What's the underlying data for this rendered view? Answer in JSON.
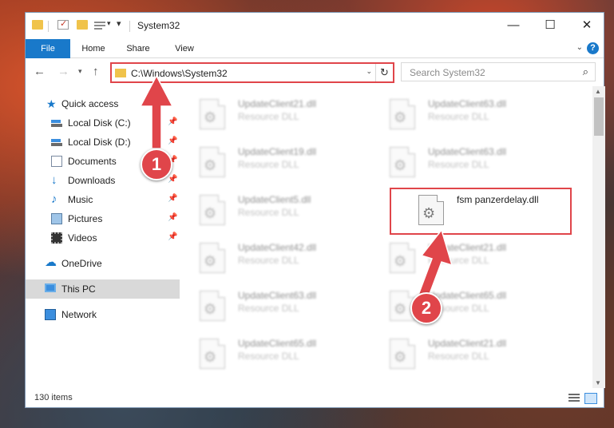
{
  "window": {
    "title": "System32"
  },
  "ribbon": {
    "tabs": [
      "File",
      "Home",
      "Share",
      "View"
    ],
    "help": "?"
  },
  "nav": {
    "address": "C:\\Windows\\System32",
    "search_placeholder": "Search System32"
  },
  "sidebar": {
    "items": [
      {
        "label": "Quick access",
        "icon": "quick-access-star-icon",
        "pinned": false
      },
      {
        "label": "Local Disk (C:)",
        "icon": "disk-icon",
        "pinned": true
      },
      {
        "label": "Local Disk (D:)",
        "icon": "disk-icon",
        "pinned": true
      },
      {
        "label": "Documents",
        "icon": "documents-icon",
        "pinned": true
      },
      {
        "label": "Downloads",
        "icon": "downloads-icon",
        "pinned": true
      },
      {
        "label": "Music",
        "icon": "music-icon",
        "pinned": true
      },
      {
        "label": "Pictures",
        "icon": "pictures-icon",
        "pinned": true
      },
      {
        "label": "Videos",
        "icon": "videos-icon",
        "pinned": true
      },
      {
        "label": "OneDrive",
        "icon": "onedrive-icon",
        "pinned": false
      },
      {
        "label": "This PC",
        "icon": "this-pc-icon",
        "pinned": false,
        "selected": true
      },
      {
        "label": "Network",
        "icon": "network-icon",
        "pinned": false
      }
    ]
  },
  "files": {
    "left": [
      {
        "name": "UpdateClient21.dll",
        "type": "Resource DLL"
      },
      {
        "name": "UpdateClient19.dll",
        "type": "Resource DLL"
      },
      {
        "name": "UpdateClient5.dll",
        "type": "Resource DLL"
      },
      {
        "name": "UpdateClient42.dll",
        "type": "Resource DLL"
      },
      {
        "name": "UpdateClient63.dll",
        "type": "Resource DLL"
      },
      {
        "name": "UpdateClient65.dll",
        "type": "Resource DLL"
      }
    ],
    "right": [
      {
        "name": "UpdateClient63.dll",
        "type": "Resource DLL"
      },
      {
        "name": "UpdateClient63.dll",
        "type": "Resource DLL"
      },
      {
        "name": "fsm panzerdelay.dll",
        "type": "",
        "highlighted": true
      },
      {
        "name": "UpdateClient21.dll",
        "type": "Resource DLL"
      },
      {
        "name": "UpdateClient65.dll",
        "type": "Resource DLL"
      },
      {
        "name": "UpdateClient21.dll",
        "type": "Resource DLL"
      }
    ]
  },
  "status": {
    "items": "130 items"
  },
  "annotations": {
    "step1": "1",
    "step2": "2"
  },
  "colors": {
    "accent": "#1979ca",
    "highlight": "#e0454a",
    "folder": "#f0c34b"
  }
}
